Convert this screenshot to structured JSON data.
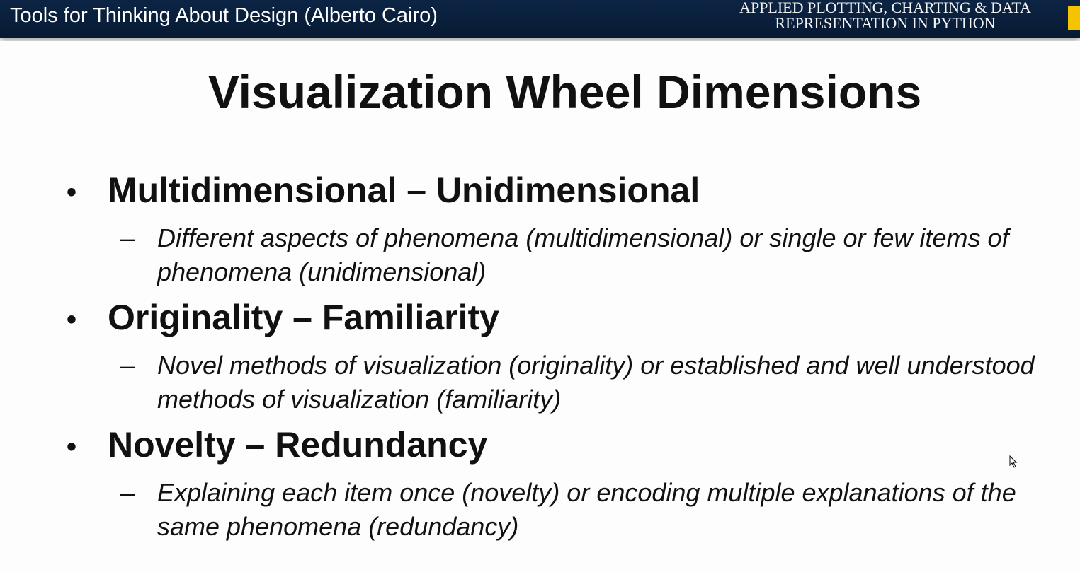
{
  "header": {
    "title": "Tools for Thinking About Design (Alberto Cairo)",
    "course_line1": "APPLIED PLOTTING, CHARTING & DATA",
    "course_line2": "REPRESENTATION IN PYTHON"
  },
  "slide": {
    "title": "Visualization Wheel Dimensions",
    "bullets": [
      {
        "heading": "Multidimensional – Unidimensional",
        "detail": "Different aspects of phenomena (multidimensional) or single or few items of phenomena (unidimensional)"
      },
      {
        "heading": "Originality – Familiarity",
        "detail": "Novel methods of visualization (originality) or established and well understood methods of visualization (familiarity)"
      },
      {
        "heading": "Novelty – Redundancy",
        "detail": "Explaining each item once (novelty) or encoding multiple explanations of the same phenomena (redundancy)"
      }
    ],
    "bullet_char": "•",
    "dash_char": "–"
  }
}
